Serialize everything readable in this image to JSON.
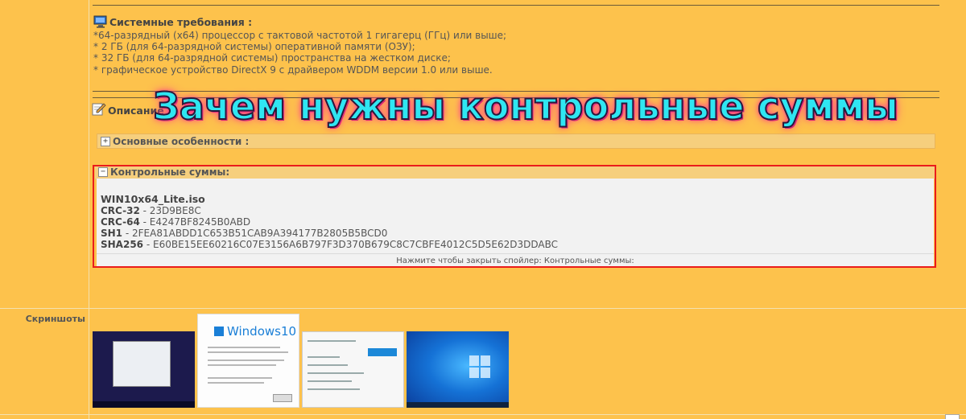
{
  "system_requirements": {
    "title": "Системные требования :",
    "items": [
      "*64-разрядный (x64) процессор с тактовой частотой 1 гигагерц (ГГц) или выше;",
      "* 2 ГБ (для 64-разрядной системы) оперативной памяти (ОЗУ);",
      "* 32 ГБ (для 64-разрядной системы) пространства на жестком диске;",
      "* графическое устройство DirectX 9 с драйвером WDDM версии 1.0 или выше."
    ]
  },
  "description": {
    "label": "Описание",
    "overlay_title": "Зачем нужны контрольные суммы"
  },
  "spoiler_features": {
    "toggle": "+",
    "label": "Основные особенности :"
  },
  "spoiler_checksums": {
    "toggle": "−",
    "label": "Контрольные суммы:",
    "file_name": "WIN10x64_Lite.iso",
    "hashes": [
      {
        "algo": "CRC-32",
        "sep": " - ",
        "value": "23D9BE8C"
      },
      {
        "algo": "CRC-64",
        "sep": " - ",
        "value": "E4247BF8245B0ABD"
      },
      {
        "algo": "SH1",
        "sep": " - ",
        "value": "2FEA81ABDD1C653B51CAB9A394177B2805B5BCD0"
      },
      {
        "algo": "SHA256",
        "sep": " - ",
        "value": "E60BE15EE60216C07E3156A6B797F3D370B679C8C7CBFE4012C5D5E62D3DDABC"
      }
    ],
    "close_hint": "Нажмите чтобы закрыть спойлер: Контрольные суммы:"
  },
  "screenshots": {
    "label": "Скриншоты",
    "thumb2_logo": "Windows10"
  },
  "colors": {
    "page_bg": "#fdc24c",
    "frame_red": "#ea1c1c",
    "overlay_text": "#2fe6f2",
    "overlay_glow": "#ff3b8d"
  }
}
